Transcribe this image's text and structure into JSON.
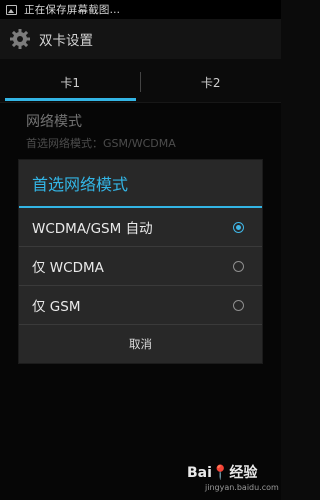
{
  "status_bar": {
    "text": "正在保存屏幕截图..."
  },
  "action_bar": {
    "title": "双卡设置"
  },
  "tabs": [
    {
      "label": "卡1",
      "active": true
    },
    {
      "label": "卡2",
      "active": false
    }
  ],
  "preference": {
    "title": "网络模式",
    "summary": "首选网络模式：GSM/WCDMA"
  },
  "dialog": {
    "title": "首选网络模式",
    "options": [
      {
        "label": "WCDMA/GSM 自动",
        "selected": true
      },
      {
        "label": "仅 WCDMA",
        "selected": false
      },
      {
        "label": "仅 GSM",
        "selected": false
      }
    ],
    "cancel_label": "取消"
  },
  "watermark": {
    "brand": "Bai📍经验",
    "url": "jingyan.baidu.com"
  },
  "colors": {
    "accent": "#33b5e5",
    "background": "#0b0b0b",
    "dialog": "#282828"
  }
}
